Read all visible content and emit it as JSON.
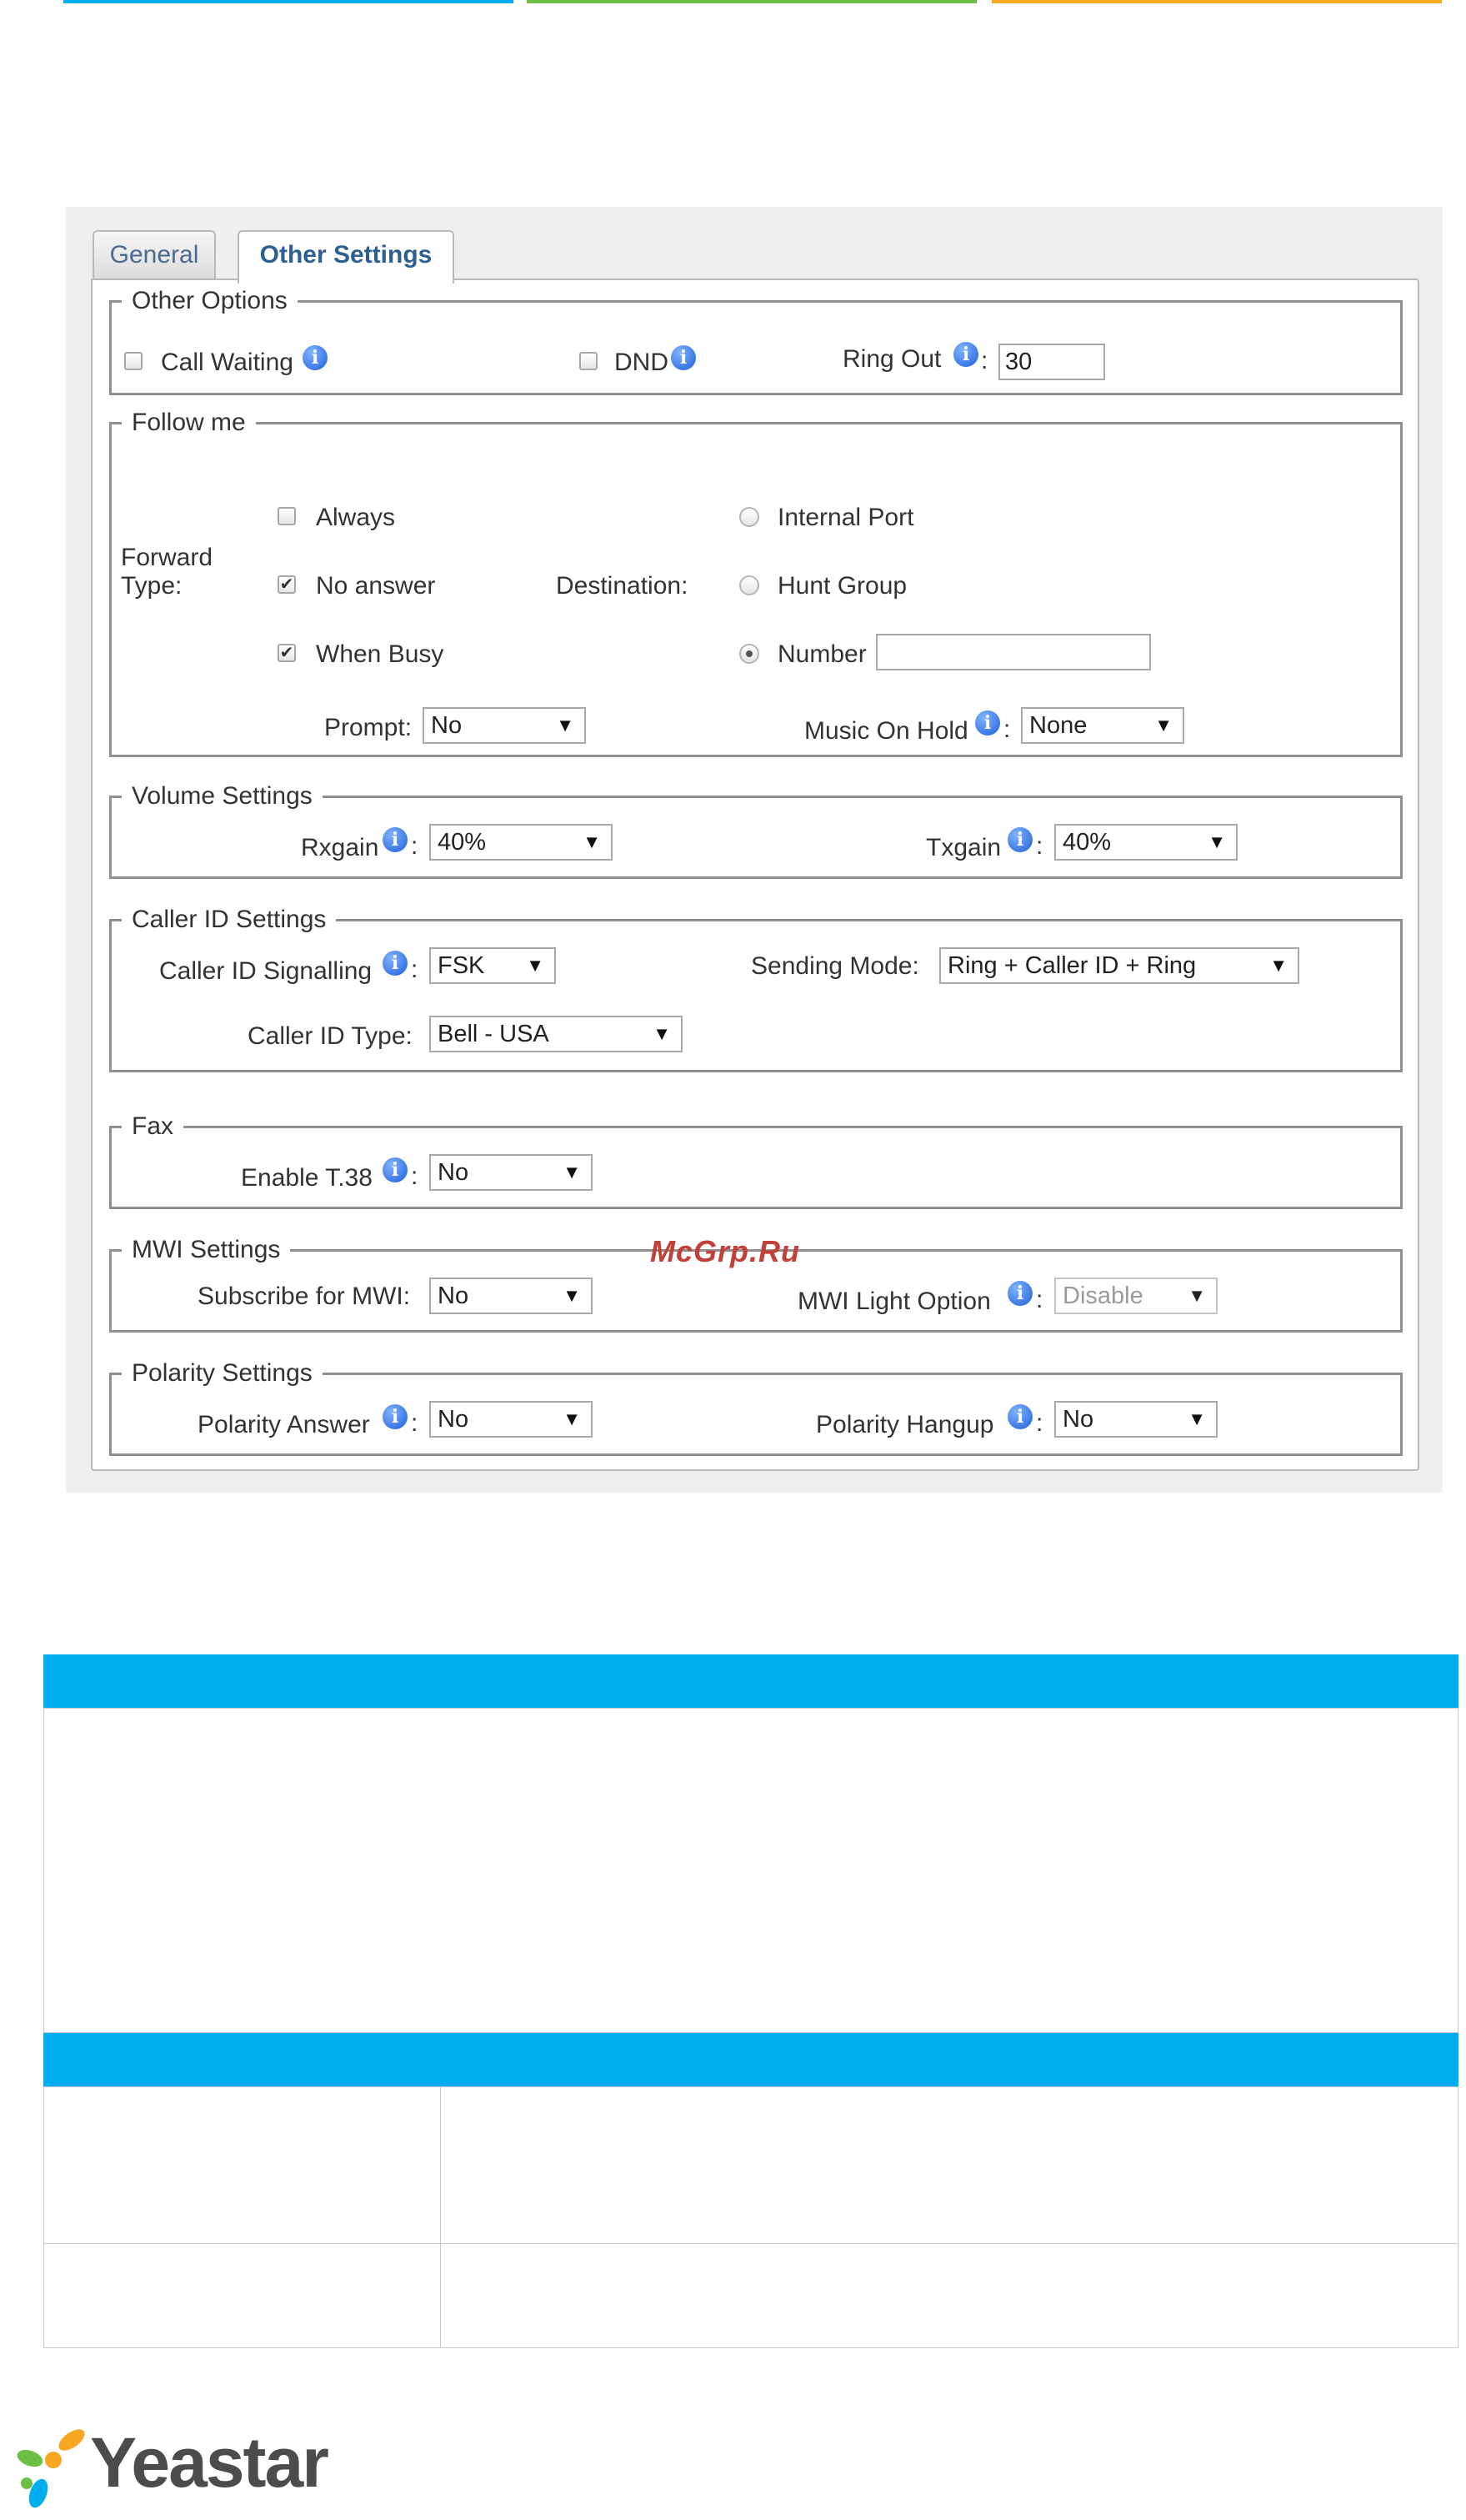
{
  "colors": {
    "top_bar_blue": "#00adef",
    "top_bar_green": "#6cbe45",
    "top_bar_orange": "#f7a823",
    "table_header": "#00adef",
    "info_icon": "#2a6fe0"
  },
  "tabs": {
    "general": "General",
    "other_settings": "Other Settings"
  },
  "other_options": {
    "legend": "Other Options",
    "call_waiting": "Call Waiting",
    "dnd": "DND",
    "ring_out_label": "Ring Out",
    "ring_out_value": "30"
  },
  "follow_me": {
    "legend": "Follow me",
    "forward_type_line1": "Forward",
    "forward_type_line2": "Type:",
    "always": "Always",
    "no_answer": "No answer",
    "when_busy": "When Busy",
    "destination": "Destination:",
    "internal_port": "Internal Port",
    "hunt_group": "Hunt Group",
    "number": "Number",
    "prompt_label": "Prompt:",
    "prompt_value": "No",
    "moh_label": "Music On Hold",
    "moh_value": "None"
  },
  "volume": {
    "legend": "Volume Settings",
    "rxgain_label": "Rxgain",
    "rxgain_value": "40%",
    "txgain_label": "Txgain",
    "txgain_value": "40%"
  },
  "caller_id": {
    "legend": "Caller ID Settings",
    "signalling_label": "Caller ID Signalling",
    "signalling_value": "FSK",
    "sending_mode_label": "Sending Mode:",
    "sending_mode_value": "Ring + Caller ID + Ring",
    "type_label": "Caller ID Type:",
    "type_value": "Bell - USA"
  },
  "fax": {
    "legend": "Fax",
    "t38_label": "Enable T.38",
    "t38_value": "No"
  },
  "mwi": {
    "legend": "MWI Settings",
    "subscribe_label": "Subscribe for MWI:",
    "subscribe_value": "No",
    "light_label": "MWI Light Option",
    "light_value": "Disable"
  },
  "polarity": {
    "legend": "Polarity Settings",
    "answer_label": "Polarity Answer",
    "answer_value": "No",
    "hangup_label": "Polarity Hangup",
    "hangup_value": "No"
  },
  "watermark": "McGrp.Ru",
  "colon": ":",
  "logo": {
    "text": "Yeastar"
  }
}
